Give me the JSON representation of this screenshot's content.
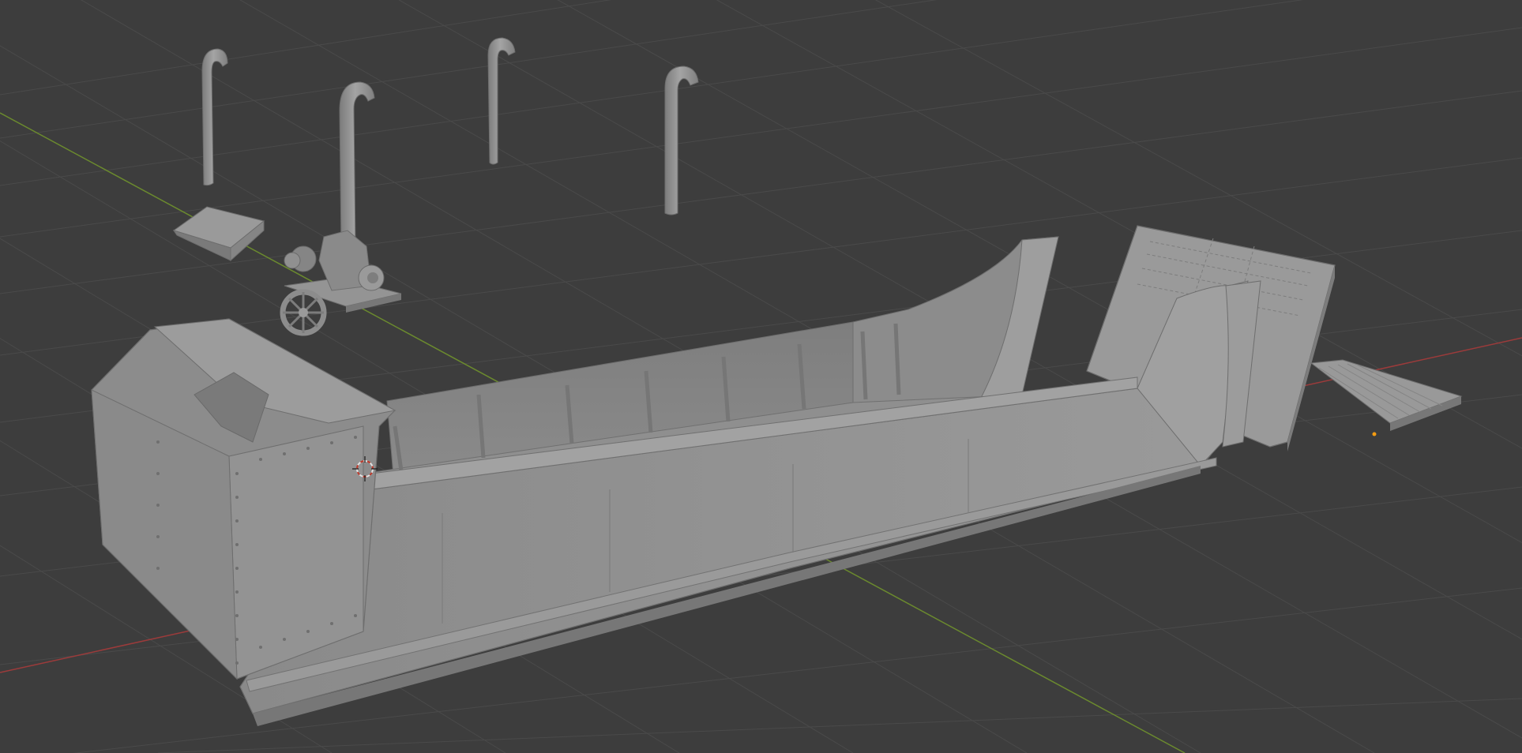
{
  "app": "3D viewport",
  "viewport": {
    "background": "#3d3d3d",
    "grid_color": "#4a4a4a",
    "x_axis_color": "#9c3b3b",
    "y_axis_color": "#6b8a2e",
    "mesh_color": "#8f8f8f"
  },
  "scene": {
    "objects": [
      {
        "name": "hull",
        "icon": "boat-hull"
      },
      {
        "name": "ramp",
        "icon": "ramp-door"
      },
      {
        "name": "ramp-grate",
        "icon": "ramp-grate"
      },
      {
        "name": "winch",
        "icon": "winch"
      },
      {
        "name": "exhaust-pipe-1",
        "icon": "pipe"
      },
      {
        "name": "exhaust-pipe-2",
        "icon": "pipe"
      },
      {
        "name": "exhaust-pipe-3",
        "icon": "pipe"
      },
      {
        "name": "exhaust-pipe-4",
        "icon": "pipe"
      },
      {
        "name": "hatch-cover",
        "icon": "wedge"
      }
    ],
    "cursor_icon": "3d-cursor-icon",
    "origin_icon": "object-origin-icon"
  }
}
